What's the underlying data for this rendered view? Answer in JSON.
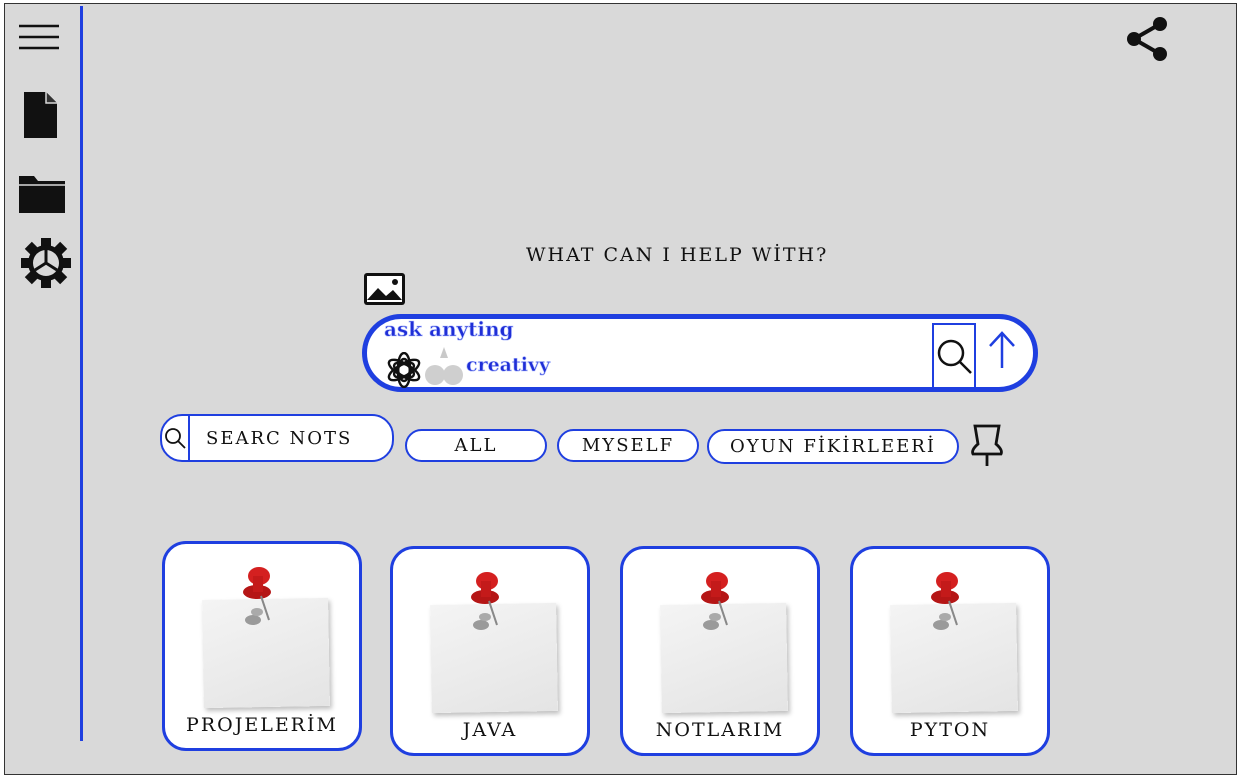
{
  "sidebar": {
    "icons": [
      "menu-icon",
      "document-icon",
      "folder-icon",
      "settings-icon"
    ]
  },
  "header": {
    "share_icon": "share-icon"
  },
  "main": {
    "heading": "WHAT CAN I HELP WİTH?",
    "ask_placeholder": "ask anyting",
    "mode_label": "creativy",
    "icons": [
      "image-icon",
      "openai-icon",
      "drops-icon",
      "search-icon",
      "send-arrow-icon"
    ]
  },
  "filters": {
    "search_label": "SEARC NOTS",
    "tabs": [
      "ALL",
      "MYSELF",
      "OYUN FİKİRLEERİ"
    ],
    "pin_icon": "pin-icon"
  },
  "notes": [
    {
      "label": "PROJELERİM"
    },
    {
      "label": "JAVA"
    },
    {
      "label": "NOTLARIM"
    },
    {
      "label": "PYTON"
    }
  ],
  "colors": {
    "accent": "#1f3fe0",
    "background": "#d9d9d9",
    "pin": "#d42020"
  }
}
